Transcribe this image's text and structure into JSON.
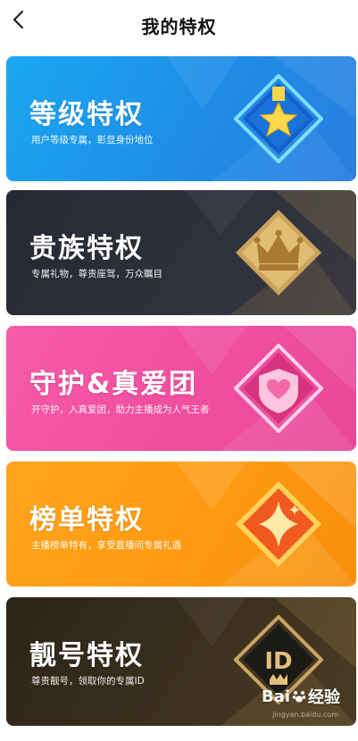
{
  "header": {
    "title": "我的特权",
    "back_icon": "chevron-left-icon"
  },
  "cards": [
    {
      "title": "等级特权",
      "subtitle": "用户等级专属，彰显身份地位",
      "icon": "star-badge-icon",
      "color": "#1f8de8"
    },
    {
      "title": "贵族特权",
      "subtitle": "专属礼物，尊贵座驾，万众瞩目",
      "icon": "crown-badge-icon",
      "color": "#2f313c"
    },
    {
      "title": "守护&真爱团",
      "subtitle": "开守护，入真爱团，助力主播成为人气王者",
      "icon": "heart-shield-badge-icon",
      "color": "#f04e9f"
    },
    {
      "title": "榜单特权",
      "subtitle": "主播榜单特有，享受直播间专属礼遇",
      "icon": "sparkle-badge-icon",
      "color": "#ff9a12"
    },
    {
      "title": "靓号特权",
      "subtitle": "尊贵靓号，领取你的专属ID",
      "icon": "id-badge-icon",
      "color": "#3b3020"
    }
  ],
  "watermark": {
    "logo": "Bai",
    "brand": "经验",
    "url": "jingyan.baidu.com"
  }
}
